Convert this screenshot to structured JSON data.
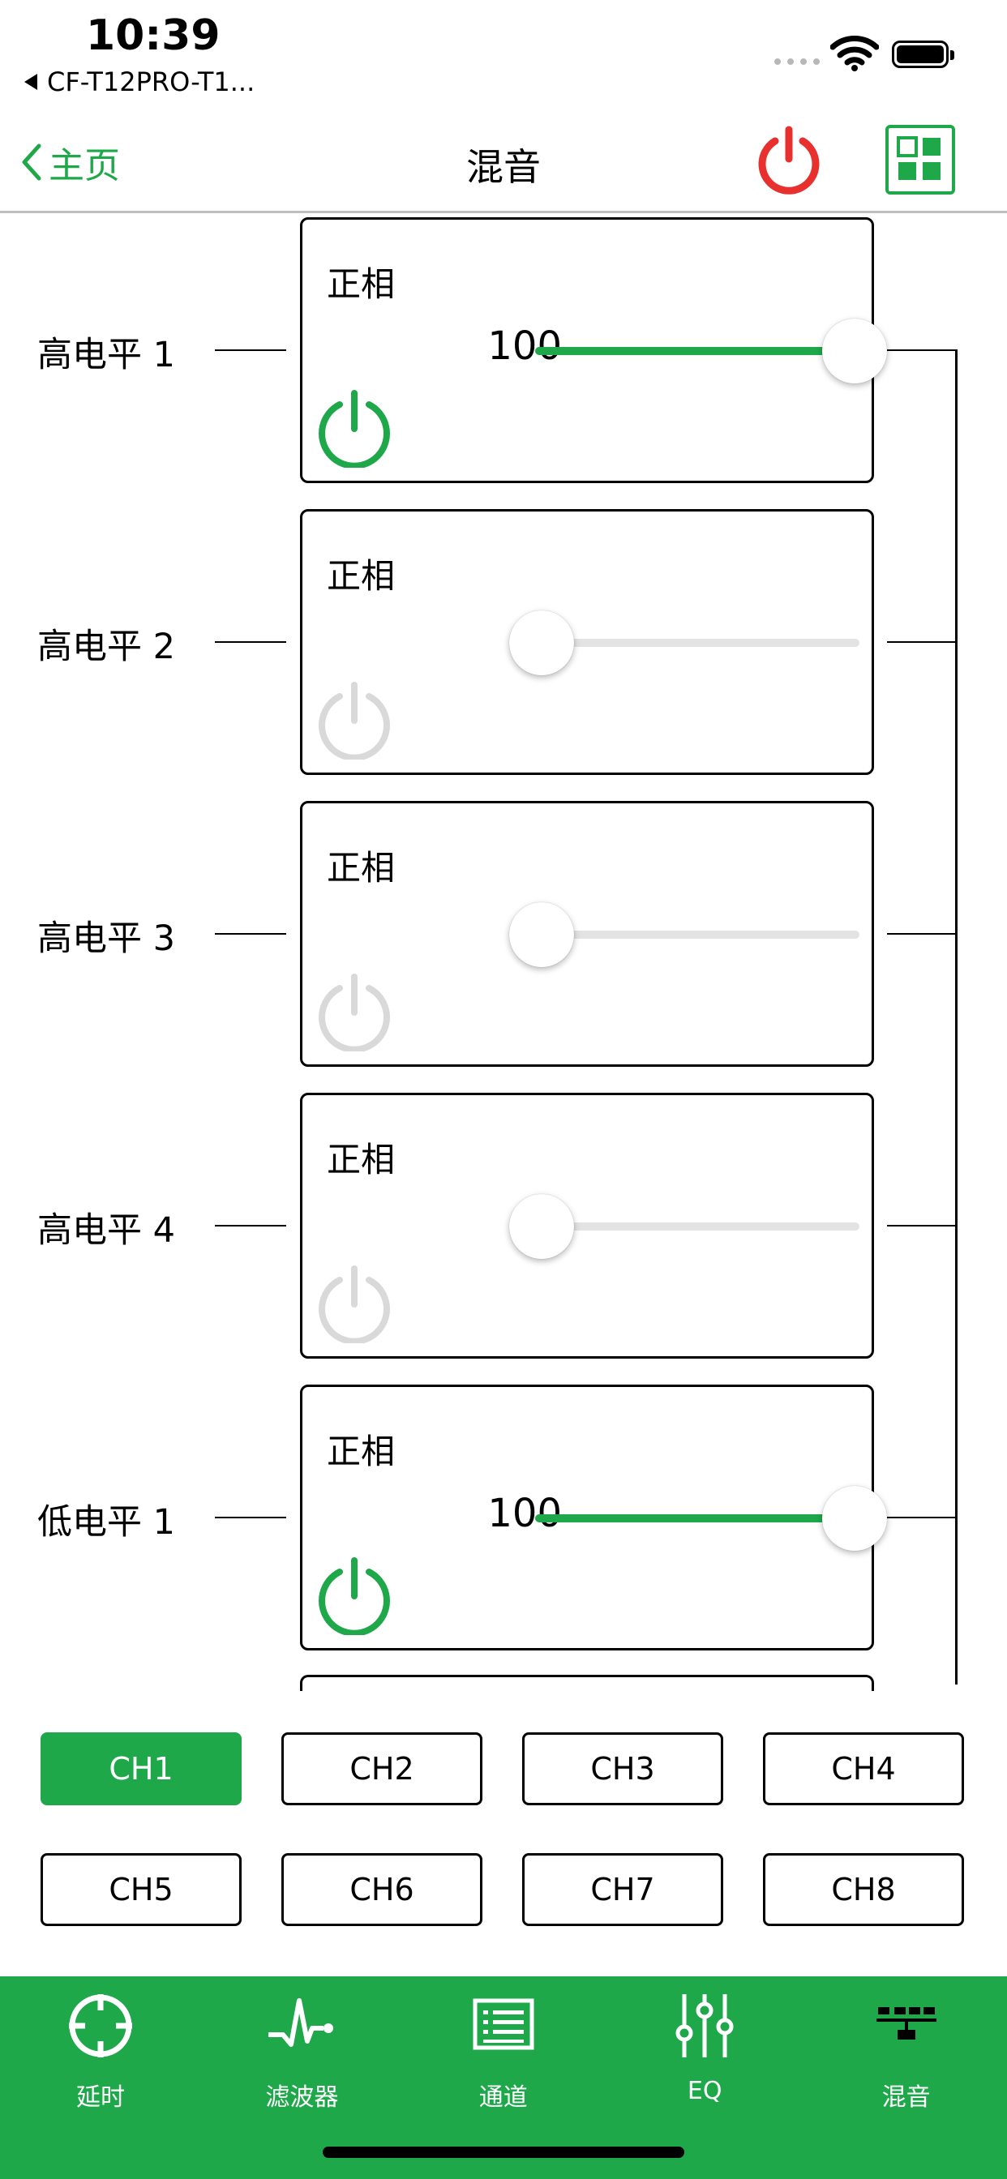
{
  "status_bar": {
    "time": "10:39",
    "back_app": "CF-T12PRO-T1..."
  },
  "nav": {
    "back_label": "主页",
    "title": "混音"
  },
  "colors": {
    "accent": "#1fa84a",
    "power_red": "#e8312f",
    "inactive_gray": "#d9d9d9"
  },
  "rows": [
    {
      "label": "高电平 1",
      "phase": "正相",
      "value": "100",
      "level": 1.0,
      "enabled": true
    },
    {
      "label": "高电平 2",
      "phase": "正相",
      "value": "0",
      "level": 0.0,
      "enabled": false
    },
    {
      "label": "高电平 3",
      "phase": "正相",
      "value": "0",
      "level": 0.0,
      "enabled": false
    },
    {
      "label": "高电平 4",
      "phase": "正相",
      "value": "0",
      "level": 0.0,
      "enabled": false
    },
    {
      "label": "低电平 1",
      "phase": "正相",
      "value": "100",
      "level": 1.0,
      "enabled": true
    }
  ],
  "channels": [
    "CH1",
    "CH2",
    "CH3",
    "CH4",
    "CH5",
    "CH6",
    "CH7",
    "CH8"
  ],
  "selected_channel": "CH1",
  "tabs": [
    {
      "label": "延时",
      "icon": "crosshair-icon"
    },
    {
      "label": "滤波器",
      "icon": "waveform-icon"
    },
    {
      "label": "通道",
      "icon": "channel-list-icon"
    },
    {
      "label": "EQ",
      "icon": "sliders-icon"
    },
    {
      "label": "混音",
      "icon": "mixer-icon"
    }
  ]
}
